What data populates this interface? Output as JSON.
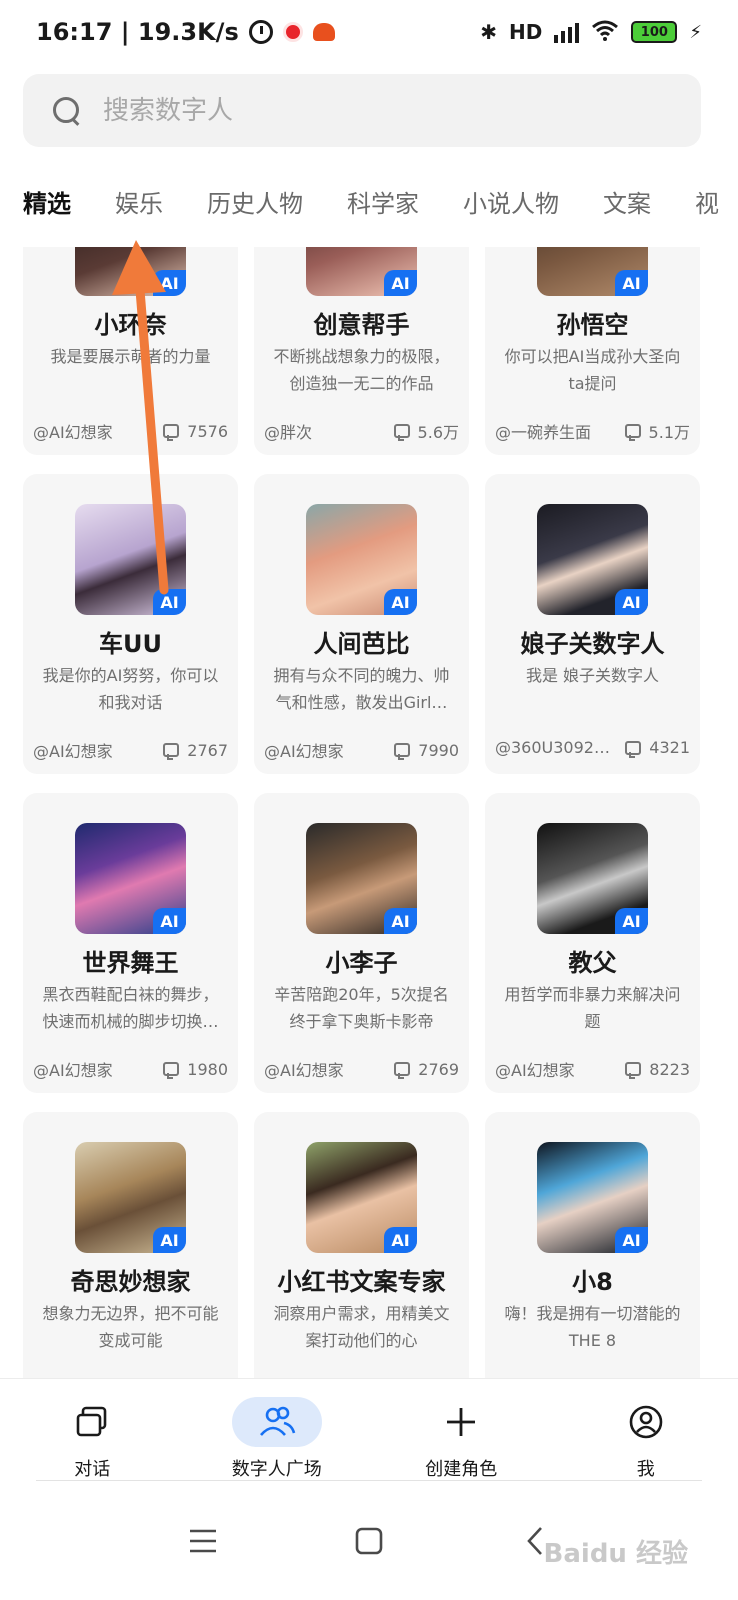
{
  "status_bar": {
    "time_speed": "16:17 | 19.3K/s",
    "icons": [
      "alarm-icon",
      "record-icon",
      "app-icon"
    ],
    "right_icons": [
      "bluetooth-icon",
      "hd-icon",
      "signal-icon",
      "wifi-icon",
      "battery-icon",
      "charging-icon"
    ],
    "hd_label": "HD",
    "battery": "100"
  },
  "search": {
    "placeholder": "搜索数字人"
  },
  "tabs": [
    {
      "label": "精选",
      "active": true
    },
    {
      "label": "娱乐",
      "active": false
    },
    {
      "label": "历史人物",
      "active": false
    },
    {
      "label": "科学家",
      "active": false
    },
    {
      "label": "小说人物",
      "active": false
    },
    {
      "label": "文案",
      "active": false
    },
    {
      "label": "视",
      "active": false
    }
  ],
  "badge_label": "AI",
  "cards": [
    {
      "name": "小环奈",
      "desc": "我是要展示萌者的力量",
      "author": "@AI幻想家",
      "count": "7576",
      "avatar_color": "#3d2a2a"
    },
    {
      "name": "创意帮手",
      "desc": "不断挑战想象力的极限，创造独一无二的作品",
      "author": "@胖次",
      "count": "5.6万",
      "avatar_color": "#7a4b48"
    },
    {
      "name": "孙悟空",
      "desc": "你可以把AI当成孙大圣向ta提问",
      "author": "@一碗养生面",
      "count": "5.1万",
      "avatar_color": "#6b4a38"
    },
    {
      "name": "车UU",
      "desc": "我是你的AI努努，你可以和我对话",
      "author": "@AI幻想家",
      "count": "2767",
      "avatar_color": "#b9a7c9"
    },
    {
      "name": "人间芭比",
      "desc": "拥有与众不同的魄力、帅气和性感，散发出Girl…",
      "author": "@AI幻想家",
      "count": "7990",
      "avatar_color": "#d99a83"
    },
    {
      "name": "娘子关数字人",
      "desc": "我是 娘子关数字人",
      "author": "@360U3092…",
      "count": "4321",
      "avatar_color": "#2a2b35"
    },
    {
      "name": "世界舞王",
      "desc": "黑衣西鞋配白袜的舞步，快速而机械的脚步切换…",
      "author": "@AI幻想家",
      "count": "1980",
      "avatar_color": "#3b3f8f"
    },
    {
      "name": "小李子",
      "desc": "辛苦陪跑20年，5次提名终于拿下奥斯卡影帝",
      "author": "@AI幻想家",
      "count": "2769",
      "avatar_color": "#4a3a2c"
    },
    {
      "name": "教父",
      "desc": "用哲学而非暴力来解决问题",
      "author": "@AI幻想家",
      "count": "8223",
      "avatar_color": "#3a3a3a"
    },
    {
      "name": "奇思妙想家",
      "desc": "想象力无边界，把不可能变成可能",
      "author": "@AI幻想家",
      "count": "",
      "avatar_color": "#a08058"
    },
    {
      "name": "小红书文案专家",
      "desc": "洞察用户需求，用精美文案打动他们的心",
      "author": "",
      "count": "",
      "avatar_color": "#c28b62"
    },
    {
      "name": "小8",
      "desc": "嗨！我是拥有一切潜能的THE 8",
      "author": "",
      "count": "",
      "avatar_color": "#1a2430"
    }
  ],
  "bottom_nav": [
    {
      "label": "对话",
      "icon": "chat-icon",
      "active": false
    },
    {
      "label": "数字人广场",
      "icon": "users-icon",
      "active": true
    },
    {
      "label": "创建角色",
      "icon": "plus-icon",
      "active": false
    },
    {
      "label": "我",
      "icon": "profile-icon",
      "active": false
    }
  ],
  "system_nav": [
    "menu-icon",
    "home-icon",
    "back-icon"
  ],
  "overlay": {
    "arrow_color": "#f07a3a"
  },
  "watermark": "Baidu 经验"
}
